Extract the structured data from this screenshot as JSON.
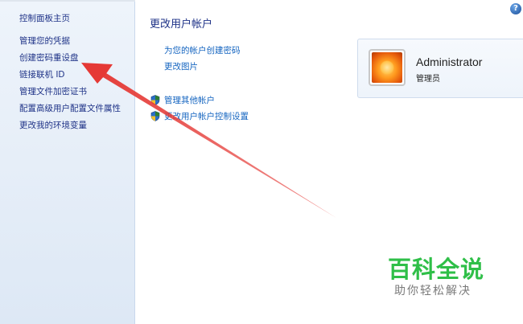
{
  "sidebar": {
    "home": "控制面板主页",
    "items": [
      {
        "label": "管理您的凭据"
      },
      {
        "label": "创建密码重设盘"
      },
      {
        "label": "链接联机 ID"
      },
      {
        "label": "管理文件加密证书"
      },
      {
        "label": "配置高级用户配置文件属性"
      },
      {
        "label": "更改我的环境变量"
      }
    ]
  },
  "main": {
    "title": "更改用户帐户",
    "links": {
      "create_password": "为您的帐户创建密码",
      "change_picture": "更改图片",
      "manage_other": "管理其他帐户",
      "uac_settings": "更改用户帐户控制设置"
    }
  },
  "account": {
    "name": "Administrator",
    "role": "管理员"
  },
  "help": {
    "glyph": "?"
  },
  "watermark": {
    "title": "百科全说",
    "subtitle": "助你轻松解决"
  },
  "colors": {
    "arrow": "#e53935",
    "link": "#1565c0",
    "watermark": "#2fbf48"
  }
}
